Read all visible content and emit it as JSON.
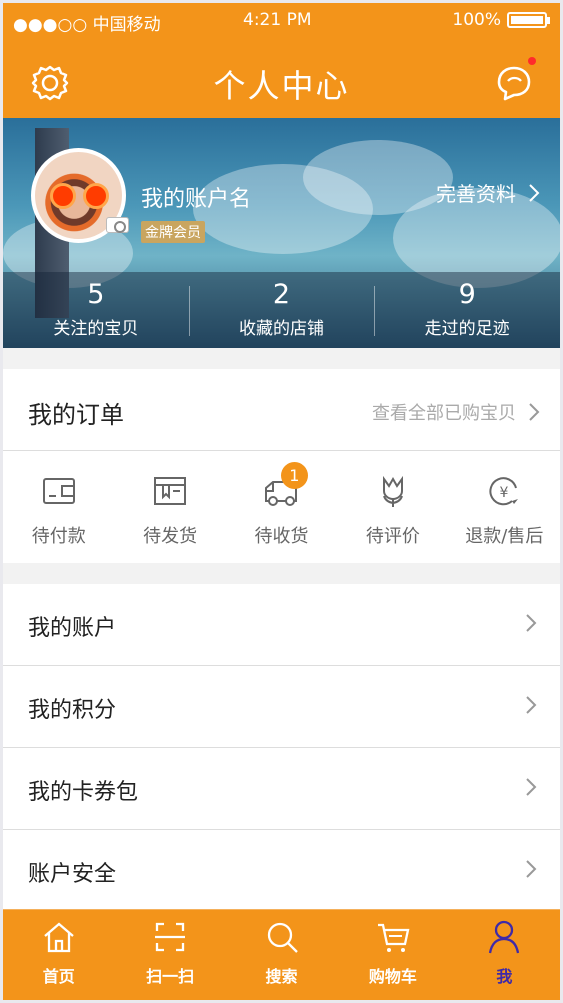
{
  "status": {
    "carrier": "●●●○○ 中国移动",
    "time": "4:21 PM",
    "battery": "100%"
  },
  "header": {
    "title": "个人中心",
    "settings_icon": "settings-icon",
    "message_icon": "message-icon"
  },
  "profile": {
    "username": "我的账户名",
    "member": "金牌会员",
    "edit": "完善资料",
    "stats": [
      {
        "value": "5",
        "label": "关注的宝贝"
      },
      {
        "value": "2",
        "label": "收藏的店铺"
      },
      {
        "value": "9",
        "label": "走过的足迹"
      }
    ]
  },
  "orders": {
    "title": "我的订单",
    "view_all": "查看全部已购宝贝",
    "items": [
      {
        "label": "待付款",
        "icon": "wallet-icon"
      },
      {
        "label": "待发货",
        "icon": "package-icon"
      },
      {
        "label": "待收货",
        "icon": "truck-icon",
        "badge": "1"
      },
      {
        "label": "待评价",
        "icon": "tulip-icon"
      },
      {
        "label": "退款/售后",
        "icon": "refund-icon"
      }
    ]
  },
  "menu": [
    {
      "label": "我的账户"
    },
    {
      "label": "我的积分"
    },
    {
      "label": "我的卡券包"
    },
    {
      "label": "账户安全"
    }
  ],
  "tabs": [
    {
      "label": "首页",
      "icon": "home-icon"
    },
    {
      "label": "扫一扫",
      "icon": "scan-icon"
    },
    {
      "label": "搜索",
      "icon": "search-icon"
    },
    {
      "label": "购物车",
      "icon": "cart-icon"
    },
    {
      "label": "我",
      "icon": "profile-icon",
      "active": true
    }
  ],
  "colors": {
    "accent": "#f3941a",
    "active_tab": "#3f2aa8",
    "dot": "#ff2b2b"
  }
}
